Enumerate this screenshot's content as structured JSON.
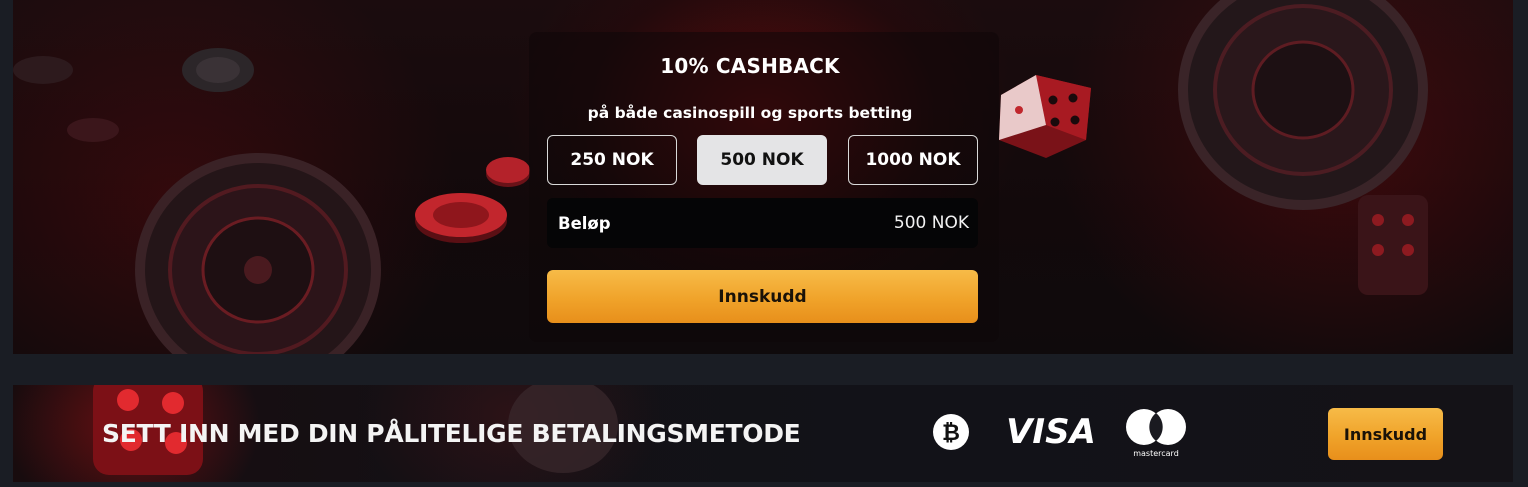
{
  "promo": {
    "title": "10% CASHBACK",
    "subtitle": "på både casinospill og sports betting",
    "amount_options": [
      "250 NOK",
      "500 NOK",
      "1000 NOK"
    ],
    "selected_amount": "500 NOK",
    "amount_field": {
      "label": "Beløp",
      "value": "500 NOK"
    },
    "deposit_label": "Innskudd"
  },
  "payment_banner": {
    "title": "SETT INN MED DIN PÅLITELIGE BETALINGSMETODE",
    "methods": [
      {
        "icon": "bitcoin-icon"
      },
      {
        "icon": "visa-icon",
        "text": "VISA"
      },
      {
        "icon": "mastercard-icon",
        "text": "mastercard"
      }
    ],
    "deposit_label": "Innskudd"
  },
  "colors": {
    "accent": "#f0a32a",
    "background": "#1a1d24",
    "selected_option": "#e4e4e6"
  }
}
